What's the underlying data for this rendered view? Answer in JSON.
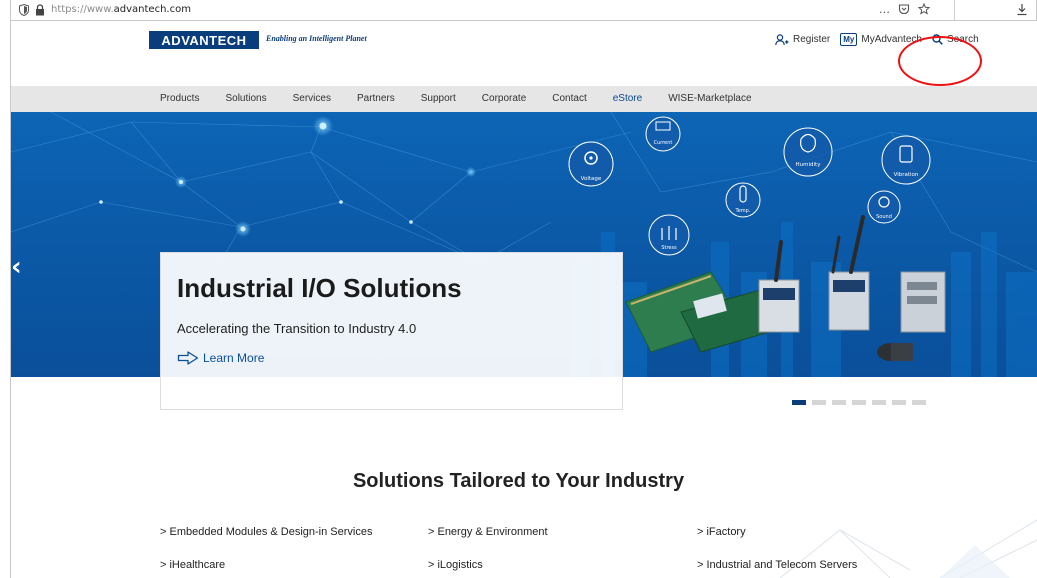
{
  "browser": {
    "url_prefix": "https://www.",
    "url_domain": "advantech.com",
    "more_icon": "…",
    "pocket_icon": "pocket-icon",
    "star_icon": "star-icon",
    "download_icon": "download-icon"
  },
  "header": {
    "logo_text": "ADVANTECH",
    "tagline": "Enabling an Intelligent Planet",
    "register_label": "Register",
    "myadvantech_badge": "My",
    "myadvantech_label": "MyAdvantech",
    "search_label": "Search"
  },
  "nav": {
    "items": [
      "Products",
      "Solutions",
      "Services",
      "Partners",
      "Support",
      "Corporate",
      "Contact",
      "eStore",
      "WISE-Marketplace"
    ]
  },
  "hero": {
    "title": "Industrial I/O Solutions",
    "subtitle": "Accelerating the Transition to Industry 4.0",
    "cta": "Learn More",
    "sensor_labels": [
      "Voltage",
      "Current",
      "Humidity",
      "Vibration",
      "Temp.",
      "Sound",
      "Stress"
    ],
    "slide_count": 7,
    "active_slide": 1
  },
  "solutions": {
    "title": "Solutions Tailored to Your Industry",
    "items": [
      "> Embedded Modules & Design-in Services",
      "> Energy & Environment",
      "> iFactory",
      "> iHealthcare",
      "> iLogistics",
      "> Industrial and Telecom Servers"
    ]
  },
  "colors": {
    "brand": "#0a3d7c",
    "hero_blue": "#0b5aa8",
    "annotation_red": "#ee1111"
  }
}
